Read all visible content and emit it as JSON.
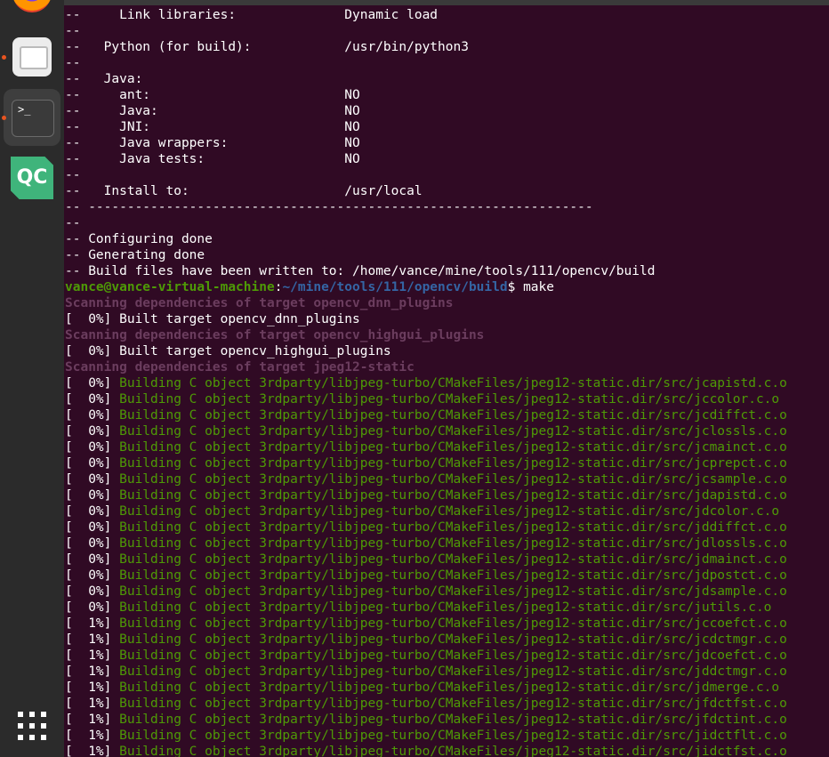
{
  "dock": {
    "apps": [
      "firefox-icon",
      "files-icon",
      "terminal-icon",
      "qt-creator-icon"
    ],
    "qc_label": "QC",
    "terminal_glyph": ">_"
  },
  "terminal": {
    "summary_lines": [
      "--     Link libraries:              Dynamic load",
      "--",
      "--   Python (for build):            /usr/bin/python3",
      "--",
      "--   Java:",
      "--     ant:                         NO",
      "--     Java:                        NO",
      "--     JNI:                         NO",
      "--     Java wrappers:               NO",
      "--     Java tests:                  NO",
      "--",
      "--   Install to:                    /usr/local",
      "-- -----------------------------------------------------------------",
      "--",
      "-- Configuring done",
      "-- Generating done",
      "-- Build files have been written to: /home/vance/mine/tools/111/opencv/build"
    ],
    "prompt": {
      "user_host": "vance@vance-virtual-machine",
      "sep": ":",
      "path": "~/mine/tools/111/opencv/build",
      "symbol": "$ ",
      "command": "make"
    },
    "scan1": "Scanning dependencies of target opencv_dnn_plugins",
    "built1": "[  0%] Built target opencv_dnn_plugins",
    "scan2": "Scanning dependencies of target opencv_highgui_plugins",
    "built2": "[  0%] Built target opencv_highgui_plugins",
    "scan3": "Scanning dependencies of target jpeg12-static",
    "build_lines": [
      {
        "pct": "[  0%] ",
        "text": "Building C object 3rdparty/libjpeg-turbo/CMakeFiles/jpeg12-static.dir/src/jcapistd.c.o"
      },
      {
        "pct": "[  0%] ",
        "text": "Building C object 3rdparty/libjpeg-turbo/CMakeFiles/jpeg12-static.dir/src/jccolor.c.o"
      },
      {
        "pct": "[  0%] ",
        "text": "Building C object 3rdparty/libjpeg-turbo/CMakeFiles/jpeg12-static.dir/src/jcdiffct.c.o"
      },
      {
        "pct": "[  0%] ",
        "text": "Building C object 3rdparty/libjpeg-turbo/CMakeFiles/jpeg12-static.dir/src/jclossls.c.o"
      },
      {
        "pct": "[  0%] ",
        "text": "Building C object 3rdparty/libjpeg-turbo/CMakeFiles/jpeg12-static.dir/src/jcmainct.c.o"
      },
      {
        "pct": "[  0%] ",
        "text": "Building C object 3rdparty/libjpeg-turbo/CMakeFiles/jpeg12-static.dir/src/jcprepct.c.o"
      },
      {
        "pct": "[  0%] ",
        "text": "Building C object 3rdparty/libjpeg-turbo/CMakeFiles/jpeg12-static.dir/src/jcsample.c.o"
      },
      {
        "pct": "[  0%] ",
        "text": "Building C object 3rdparty/libjpeg-turbo/CMakeFiles/jpeg12-static.dir/src/jdapistd.c.o"
      },
      {
        "pct": "[  0%] ",
        "text": "Building C object 3rdparty/libjpeg-turbo/CMakeFiles/jpeg12-static.dir/src/jdcolor.c.o"
      },
      {
        "pct": "[  0%] ",
        "text": "Building C object 3rdparty/libjpeg-turbo/CMakeFiles/jpeg12-static.dir/src/jddiffct.c.o"
      },
      {
        "pct": "[  0%] ",
        "text": "Building C object 3rdparty/libjpeg-turbo/CMakeFiles/jpeg12-static.dir/src/jdlossls.c.o"
      },
      {
        "pct": "[  0%] ",
        "text": "Building C object 3rdparty/libjpeg-turbo/CMakeFiles/jpeg12-static.dir/src/jdmainct.c.o"
      },
      {
        "pct": "[  0%] ",
        "text": "Building C object 3rdparty/libjpeg-turbo/CMakeFiles/jpeg12-static.dir/src/jdpostct.c.o"
      },
      {
        "pct": "[  0%] ",
        "text": "Building C object 3rdparty/libjpeg-turbo/CMakeFiles/jpeg12-static.dir/src/jdsample.c.o"
      },
      {
        "pct": "[  0%] ",
        "text": "Building C object 3rdparty/libjpeg-turbo/CMakeFiles/jpeg12-static.dir/src/jutils.c.o"
      },
      {
        "pct": "[  1%] ",
        "text": "Building C object 3rdparty/libjpeg-turbo/CMakeFiles/jpeg12-static.dir/src/jccoefct.c.o"
      },
      {
        "pct": "[  1%] ",
        "text": "Building C object 3rdparty/libjpeg-turbo/CMakeFiles/jpeg12-static.dir/src/jcdctmgr.c.o"
      },
      {
        "pct": "[  1%] ",
        "text": "Building C object 3rdparty/libjpeg-turbo/CMakeFiles/jpeg12-static.dir/src/jdcoefct.c.o"
      },
      {
        "pct": "[  1%] ",
        "text": "Building C object 3rdparty/libjpeg-turbo/CMakeFiles/jpeg12-static.dir/src/jddctmgr.c.o"
      },
      {
        "pct": "[  1%] ",
        "text": "Building C object 3rdparty/libjpeg-turbo/CMakeFiles/jpeg12-static.dir/src/jdmerge.c.o"
      },
      {
        "pct": "[  1%] ",
        "text": "Building C object 3rdparty/libjpeg-turbo/CMakeFiles/jpeg12-static.dir/src/jfdctfst.c.o"
      },
      {
        "pct": "[  1%] ",
        "text": "Building C object 3rdparty/libjpeg-turbo/CMakeFiles/jpeg12-static.dir/src/jfdctint.c.o"
      },
      {
        "pct": "[  1%] ",
        "text": "Building C object 3rdparty/libjpeg-turbo/CMakeFiles/jpeg12-static.dir/src/jidctflt.c.o"
      },
      {
        "pct": "[  1%] ",
        "text": "Building C object 3rdparty/libjpeg-turbo/CMakeFiles/jpeg12-static.dir/src/jidctfst.c.o"
      }
    ]
  },
  "colors": {
    "background": "#300a24",
    "green": "#4e9a06",
    "blue": "#3465a4",
    "scan": "#6b3d5e"
  }
}
